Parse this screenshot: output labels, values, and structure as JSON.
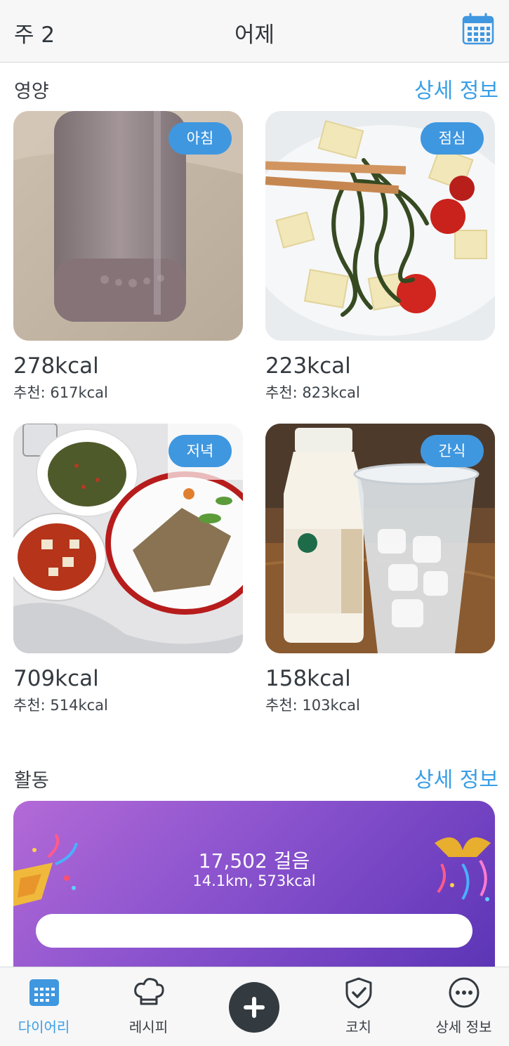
{
  "header": {
    "week": "주 2",
    "title": "어제",
    "calendar_icon": "calendar-icon"
  },
  "nutrition": {
    "title": "영양",
    "details_label": "상세 정보",
    "meals": [
      {
        "tag": "아침",
        "kcal": "278kcal",
        "recommended": "추천: 617kcal"
      },
      {
        "tag": "점심",
        "kcal": "223kcal",
        "recommended": "추천: 823kcal"
      },
      {
        "tag": "저녁",
        "kcal": "709kcal",
        "recommended": "추천: 514kcal"
      },
      {
        "tag": "간식",
        "kcal": "158kcal",
        "recommended": "추천: 103kcal"
      }
    ]
  },
  "activity": {
    "title": "활동",
    "details_label": "상세 정보",
    "steps": "17,502 걸음",
    "summary": "14.1km, 573kcal",
    "progress": 1.0
  },
  "tabbar": {
    "items": [
      {
        "label": "다이어리",
        "icon": "calendar-icon",
        "active": true
      },
      {
        "label": "레시피",
        "icon": "chef-hat-icon",
        "active": false
      },
      {
        "label": "",
        "icon": "plus-icon",
        "active": false
      },
      {
        "label": "코치",
        "icon": "shield-check-icon",
        "active": false
      },
      {
        "label": "상세 정보",
        "icon": "more-icon",
        "active": false
      }
    ]
  },
  "colors": {
    "accent": "#3a9ee6",
    "tag": "#3f97df",
    "activity_start": "#b36ad6",
    "activity_end": "#5b35b5",
    "add_button": "#343b40"
  }
}
